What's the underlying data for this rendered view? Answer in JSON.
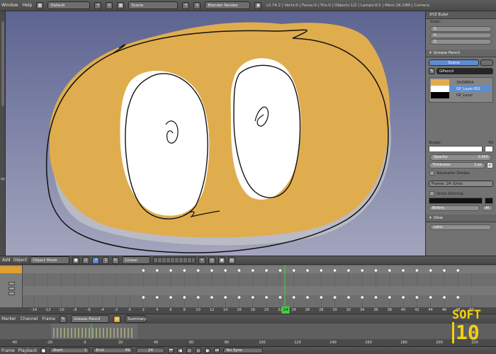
{
  "topbar": {
    "window": "Window",
    "help": "Help",
    "layout": "Default",
    "scene": "Scene",
    "engine": "Blender Render",
    "stats": "v2.74.2 | Verts:0 | Faces:0 | Tris:0 | Objects:1/2 | Lamps:0/1 | Mem:18.19M | Camera"
  },
  "left_label": "ay",
  "properties": {
    "header": "XYZ Euler",
    "scale_label": "Scale:",
    "x": "X:",
    "y": "Y:",
    "z": "Z:",
    "grease_pencil": "Grease Pencil",
    "scene_btn": "Scene",
    "gpencil_name": "GPencil",
    "layers": [
      {
        "name": "ЗАЛИВКА",
        "color": "#e0ad4e",
        "selected": false
      },
      {
        "name": "GP_Layer.001",
        "color": "#ffffff",
        "selected": true
      },
      {
        "name": "GP_Layer",
        "color": "#000000",
        "selected": false
      }
    ],
    "stroke_label": "Stroke:",
    "fill_label": "Fill",
    "opacity_label": "Opacity:",
    "opacity_value": "0.900",
    "thickness_label": "Thickness:",
    "thickness_value": "3 px",
    "volumetric": "Volumetric Strokes",
    "frame_info": "Frame: 24 (Unlo",
    "onion": "Onion Skinning",
    "before": "Before:",
    "after": "Af",
    "view": "View",
    "lens": "Lens:"
  },
  "viewhdr": {
    "add": "Add",
    "object": "Object",
    "mode": "Object Mode",
    "orientation": "Global"
  },
  "dopesheet": {
    "ruler_ticks": [
      "-14",
      "-12",
      "-10",
      "-8",
      "-6",
      "-4",
      "-2",
      "0",
      "2",
      "4",
      "6",
      "8",
      "10",
      "12",
      "14",
      "16",
      "18",
      "20",
      "22",
      "24",
      "26",
      "28",
      "30",
      "32",
      "34",
      "36",
      "38",
      "40",
      "42",
      "44",
      "46",
      "48",
      "50"
    ],
    "current_frame": "24"
  },
  "timeline_header": {
    "marker": "Marker",
    "channel": "Channel",
    "frame": "Frame",
    "mode": "Grease Pencil",
    "summary": "Summary"
  },
  "timeline": {
    "ruler_ticks": [
      "-40",
      "-20",
      "0",
      "20",
      "40",
      "60",
      "80",
      "100",
      "120",
      "140",
      "160",
      "180",
      "200",
      "220",
      "240"
    ]
  },
  "bottombar": {
    "frame": "Frame",
    "playback": "Playback",
    "start_label": "Start:",
    "start_value": "1",
    "end_label": "End:",
    "end_value": "49",
    "current": "24",
    "sync": "No Sync"
  },
  "logo": {
    "line1": "SOFT",
    "line2": "10"
  },
  "colors": {
    "fill": "#e0ad4e",
    "accent": "#5d8cd1",
    "frame_marker": "#3cd43c"
  }
}
